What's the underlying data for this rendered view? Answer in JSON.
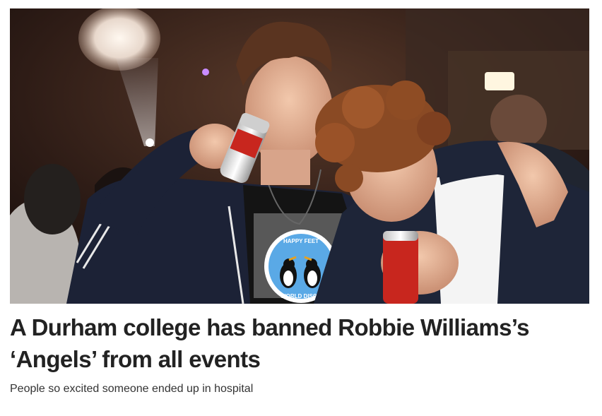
{
  "article": {
    "headline": "A Durham college has banned Robbie Williams’s ‘Angels’ from all events",
    "subheadline": "People so excited someone ended up in hospital"
  },
  "image": {
    "badge_text_top": "HAPPY FEET",
    "badge_text_bottom": "WORLD DISCO",
    "description_icon": "photo-of-two-students-drinking-cans-at-nightclub"
  },
  "colors": {
    "headline": "#222222",
    "subheadline": "#333333",
    "badge_blue": "#5aa9e6"
  }
}
